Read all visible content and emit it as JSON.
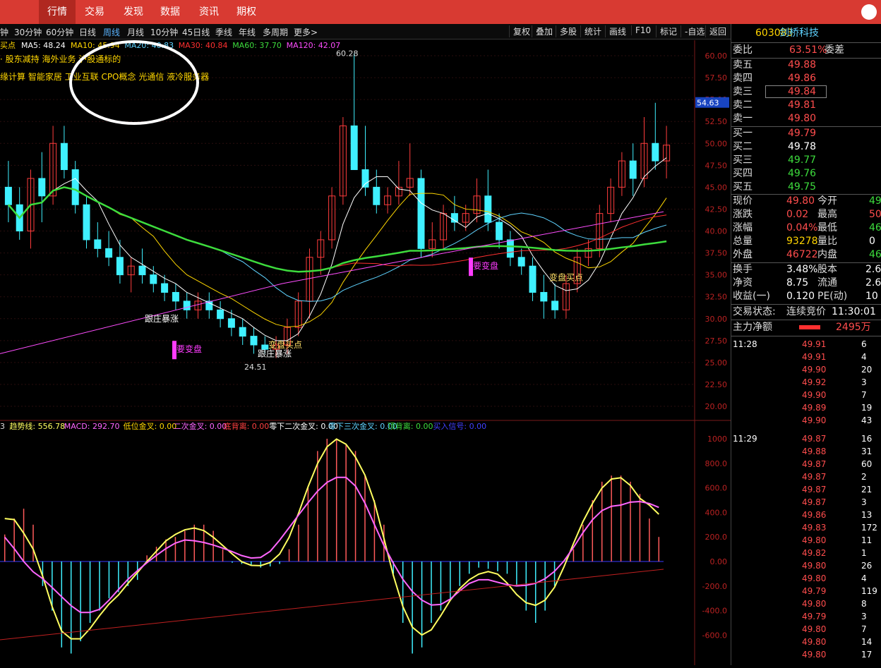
{
  "menu": [
    "行情",
    "交易",
    "发现",
    "数据",
    "资讯",
    "期权"
  ],
  "toolbar": {
    "periods": [
      "钟",
      "30分钟",
      "60分钟",
      "日线",
      "周线",
      "月线",
      "10分钟",
      "45日线",
      "季线",
      "年线",
      "多周期",
      "更多>"
    ],
    "active": "周线",
    "right": [
      "复权",
      "叠加",
      "多股",
      "统计",
      "画线",
      "F10",
      "标记",
      "-自选",
      "返回"
    ]
  },
  "main": {
    "ma_prefix": "买点",
    "ma": [
      {
        "t": "MA5: 48.24",
        "c": "#ffffff"
      },
      {
        "t": "MA10: 45.94",
        "c": "#ffd700"
      },
      {
        "t": "MA20: 40.83",
        "c": "#5fd3ff"
      },
      {
        "t": "MA30: 40.84",
        "c": "#ff3030"
      },
      {
        "t": "MA60: 37.70",
        "c": "#3ddc3d"
      },
      {
        "t": "MA120: 42.07",
        "c": "#ff4dff"
      }
    ],
    "info1": "· 股东减持 海外业务 沪股通标的",
    "info2": "缘计算 智能家居 工业互联 CPO概念 光通信 液冷服务器",
    "yticks": [
      "60.00",
      "57.50",
      "55.00",
      "52.50",
      "50.00",
      "47.50",
      "45.00",
      "42.50",
      "40.00",
      "37.50",
      "35.00",
      "32.50",
      "30.00",
      "27.50",
      "25.00",
      "22.50",
      "20.00"
    ],
    "price_tag": "54.63",
    "hi": "60.28",
    "lo": "24.51",
    "ann": [
      {
        "t": "跟庄暴涨",
        "c": "#fff"
      },
      {
        "t": "跟庄暴涨",
        "c": "#fff"
      },
      {
        "t": "要变盘",
        "c": "#ff3cff"
      },
      {
        "t": "要变盘",
        "c": "#ff3cff"
      },
      {
        "t": "变盘买点",
        "c": "#ffe066"
      },
      {
        "t": "变盘买点",
        "c": "#ffe066"
      }
    ]
  },
  "chart_data": {
    "type": "candlestick",
    "ohlc": [
      [
        45,
        48,
        41,
        43
      ],
      [
        43,
        45,
        39,
        40
      ],
      [
        40,
        47,
        38,
        46
      ],
      [
        46,
        49,
        41,
        44
      ],
      [
        44,
        52,
        43,
        50
      ],
      [
        50,
        52,
        46,
        47
      ],
      [
        47,
        48,
        42,
        43
      ],
      [
        43,
        44,
        38,
        39
      ],
      [
        39,
        41,
        37,
        38
      ],
      [
        38,
        40,
        36,
        37
      ],
      [
        37,
        39,
        34,
        35
      ],
      [
        35,
        37,
        33,
        36
      ],
      [
        36,
        38,
        34,
        35
      ],
      [
        35,
        36,
        33,
        34
      ],
      [
        34,
        35,
        32,
        33
      ],
      [
        33,
        34,
        31,
        32
      ],
      [
        32,
        33,
        30,
        31
      ],
      [
        31,
        33,
        30,
        32
      ],
      [
        32,
        33,
        30,
        31
      ],
      [
        31,
        32,
        29,
        30
      ],
      [
        30,
        31,
        28,
        29
      ],
      [
        29,
        30,
        27,
        28
      ],
      [
        28,
        29,
        26,
        27
      ],
      [
        27,
        28,
        26,
        26.5
      ],
      [
        26.5,
        28,
        25.5,
        27
      ],
      [
        27,
        30,
        26,
        29
      ],
      [
        29,
        33,
        28,
        32
      ],
      [
        32,
        38,
        30,
        37
      ],
      [
        37,
        40,
        35,
        39
      ],
      [
        39,
        45,
        38,
        44
      ],
      [
        44,
        53,
        43,
        52
      ],
      [
        52,
        60.28,
        48,
        47
      ],
      [
        47,
        52,
        44,
        45
      ],
      [
        45,
        47,
        42,
        43
      ],
      [
        43,
        45,
        42,
        44
      ],
      [
        44,
        48,
        43,
        45
      ],
      [
        45,
        50,
        44,
        46
      ],
      [
        46,
        47,
        37,
        38
      ],
      [
        38,
        41,
        37,
        39
      ],
      [
        39,
        43,
        38,
        42
      ],
      [
        42,
        44,
        40,
        41
      ],
      [
        41,
        43,
        40,
        42
      ],
      [
        42,
        46,
        41,
        44
      ],
      [
        44,
        47,
        40,
        41
      ],
      [
        41,
        42,
        38,
        39
      ],
      [
        39,
        40,
        36,
        37
      ],
      [
        37,
        38,
        35,
        36
      ],
      [
        36,
        37,
        32,
        33
      ],
      [
        33,
        35,
        30,
        32
      ],
      [
        32,
        34,
        30,
        31
      ],
      [
        31,
        35,
        30,
        34
      ],
      [
        34,
        38,
        33,
        37
      ],
      [
        37,
        39,
        36,
        38
      ],
      [
        38,
        43,
        37,
        42
      ],
      [
        42,
        46,
        41,
        45
      ],
      [
        45,
        49,
        44,
        48
      ],
      [
        48,
        50,
        44,
        46
      ],
      [
        46,
        53,
        45,
        50
      ],
      [
        50,
        54.63,
        47,
        48
      ],
      [
        48,
        52,
        46,
        49.8
      ]
    ],
    "ma": [
      {
        "name": "MA5",
        "color": "#ffffff",
        "values": [
          48.24
        ]
      },
      {
        "name": "MA10",
        "color": "#ffd700",
        "values": [
          45.94
        ]
      },
      {
        "name": "MA20",
        "color": "#5fd3ff",
        "values": [
          40.83
        ]
      },
      {
        "name": "MA30",
        "color": "#ff3030",
        "values": [
          40.84
        ]
      },
      {
        "name": "MA60",
        "color": "#3ddc3d",
        "values": [
          37.7
        ]
      },
      {
        "name": "MA120",
        "color": "#ff4dff",
        "values": [
          42.07
        ]
      }
    ],
    "ylim": [
      20,
      60
    ],
    "yticks": [
      60,
      57.5,
      55,
      52.5,
      50,
      47.5,
      45,
      42.5,
      40,
      37.5,
      35,
      32.5,
      30,
      27.5,
      25,
      22.5,
      20
    ]
  },
  "macd": {
    "header": [
      {
        "t": "3",
        "c": "#ddd"
      },
      {
        "t": "趋势线: 556.78",
        "c": "#ffff60"
      },
      {
        "t": "MACD: 292.70",
        "c": "#ff66ff"
      },
      {
        "t": "低位金叉: 0.00",
        "c": "#ffd700"
      },
      {
        "t": "二次金叉: 0.00",
        "c": "#ff66ff"
      },
      {
        "t": "底背离: 0.00",
        "c": "#ff4040"
      },
      {
        "t": "零下二次金叉: 0.00",
        "c": "#ffffff"
      },
      {
        "t": "零下三次金叉: 0.00",
        "c": "#5fd3ff"
      },
      {
        "t": "顶背离: 0.00",
        "c": "#3ddc3d"
      },
      {
        "t": "买入信号: 0.00",
        "c": "#4040ff"
      }
    ],
    "yticks": [
      "1000",
      "800.0",
      "600.0",
      "400.0",
      "200.0",
      "0.00",
      "-200.0",
      "-400.0",
      "-600.0"
    ],
    "hist": [
      220,
      350,
      430,
      300,
      -200,
      -400,
      -700,
      -750,
      -650,
      -500,
      -400,
      -300,
      -250,
      -200,
      -150,
      50,
      120,
      180,
      200,
      250,
      300,
      300,
      250,
      100,
      -10,
      -20,
      -30,
      -50,
      -40,
      -20,
      100,
      300,
      600,
      900,
      1000,
      1000,
      950,
      900,
      700,
      500,
      300,
      -100,
      -500,
      -750,
      -700,
      -500,
      -400,
      -300,
      -200,
      -100,
      -50,
      -60,
      -80,
      -100,
      -200,
      -400,
      -500,
      -400,
      -200,
      0,
      100,
      300,
      500,
      650,
      700,
      700,
      650,
      550,
      350,
      200
    ]
  },
  "panel": {
    "code": "603083",
    "name": "剑桥科技",
    "weibi_label": "委比",
    "weibi": "63.51%",
    "weicha_label": "委差",
    "sell": [
      {
        "l": "卖五",
        "p": "49.88"
      },
      {
        "l": "卖四",
        "p": "49.86"
      },
      {
        "l": "卖三",
        "p": "49.84"
      },
      {
        "l": "卖二",
        "p": "49.81"
      },
      {
        "l": "卖一",
        "p": "49.80"
      }
    ],
    "buy": [
      {
        "l": "买一",
        "p": "49.79",
        "c": "red"
      },
      {
        "l": "买二",
        "p": "49.78",
        "c": "wht"
      },
      {
        "l": "买三",
        "p": "49.77",
        "c": "grn"
      },
      {
        "l": "买四",
        "p": "49.76",
        "c": "grn"
      },
      {
        "l": "买五",
        "p": "49.75",
        "c": "grn"
      }
    ],
    "stats": [
      {
        "l": "现价",
        "v": "49.80",
        "vc": "red",
        "l2": "今开",
        "v2": "49",
        "v2c": "grn"
      },
      {
        "l": "涨跌",
        "v": "0.02",
        "vc": "red",
        "l2": "最高",
        "v2": "50",
        "v2c": "red"
      },
      {
        "l": "涨幅",
        "v": "0.04%",
        "vc": "red",
        "l2": "最低",
        "v2": "46",
        "v2c": "grn"
      },
      {
        "l": "总量",
        "v": "93278",
        "vc": "yel",
        "l2": "量比",
        "v2": "0",
        "v2c": "wht"
      },
      {
        "l": "外盘",
        "v": "46722",
        "vc": "red",
        "l2": "内盘",
        "v2": "46",
        "v2c": "grn"
      }
    ],
    "stats2": [
      {
        "l": "换手",
        "v": "3.48%",
        "l2": "股本",
        "v2": "2.6"
      },
      {
        "l": "净资",
        "v": "8.75",
        "l2": "流通",
        "v2": "2.6"
      },
      {
        "l": "收益(一)",
        "v": "0.120",
        "l2": "PE(动)",
        "v2": "10"
      }
    ],
    "state_label": "交易状态:",
    "state": "连续竞价",
    "time": "11:30:01",
    "flow_label": "主力净额",
    "flow": "2495万",
    "ticks": [
      {
        "t": "11:28",
        "p": "49.91",
        "v": "6"
      },
      {
        "t": "",
        "p": "49.91",
        "v": "4"
      },
      {
        "t": "",
        "p": "49.90",
        "v": "20"
      },
      {
        "t": "",
        "p": "49.92",
        "v": "3"
      },
      {
        "t": "",
        "p": "49.90",
        "v": "7"
      },
      {
        "t": "",
        "p": "49.89",
        "v": "19"
      },
      {
        "t": "",
        "p": "49.90",
        "v": "43"
      },
      {
        "t": "11:29",
        "p": "49.87",
        "v": "16"
      },
      {
        "t": "",
        "p": "49.88",
        "v": "31"
      },
      {
        "t": "",
        "p": "49.87",
        "v": "60"
      },
      {
        "t": "",
        "p": "49.87",
        "v": "2"
      },
      {
        "t": "",
        "p": "49.87",
        "v": "21"
      },
      {
        "t": "",
        "p": "49.87",
        "v": "3"
      },
      {
        "t": "",
        "p": "49.86",
        "v": "13"
      },
      {
        "t": "",
        "p": "49.83",
        "v": "172"
      },
      {
        "t": "",
        "p": "49.80",
        "v": "11"
      },
      {
        "t": "",
        "p": "49.82",
        "v": "1"
      },
      {
        "t": "",
        "p": "49.80",
        "v": "26"
      },
      {
        "t": "",
        "p": "49.80",
        "v": "4"
      },
      {
        "t": "",
        "p": "49.79",
        "v": "119"
      },
      {
        "t": "",
        "p": "49.80",
        "v": "8"
      },
      {
        "t": "",
        "p": "49.79",
        "v": "3"
      },
      {
        "t": "",
        "p": "49.80",
        "v": "7"
      },
      {
        "t": "",
        "p": "49.80",
        "v": "14"
      },
      {
        "t": "",
        "p": "49.80",
        "v": "17"
      }
    ]
  }
}
